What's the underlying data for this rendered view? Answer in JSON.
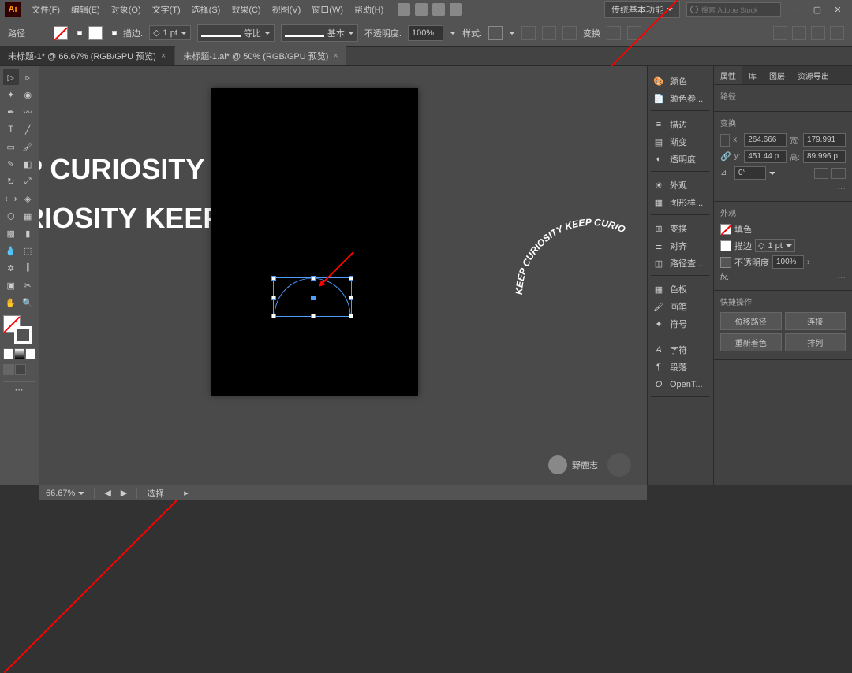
{
  "app": {
    "logo": "Ai",
    "workspace": "传统基本功能",
    "search_placeholder": "搜索 Adobe Stock"
  },
  "menu": {
    "items": [
      "文件(F)",
      "编辑(E)",
      "对象(O)",
      "文字(T)",
      "选择(S)",
      "效果(C)",
      "视图(V)",
      "窗口(W)",
      "帮助(H)"
    ]
  },
  "control": {
    "path_label": "路径",
    "stroke_label": "描边:",
    "stroke_weight": "1 pt",
    "uniform": "等比",
    "basic": "基本",
    "opacity_label": "不透明度:",
    "opacity": "100%",
    "style_label": "样式:",
    "transform_label": "变换"
  },
  "tabs": [
    {
      "label": "未标题-1* @ 66.67% (RGB/GPU 预览)",
      "active": true
    },
    {
      "label": "未标题-1.ai* @ 50% (RGB/GPU 预览)",
      "active": false
    }
  ],
  "panels": {
    "color": "颜色",
    "color_guide": "颜色参...",
    "stroke": "描边",
    "gradient": "渐变",
    "transparency": "透明度",
    "appearance": "外观",
    "graphic_styles": "图形样...",
    "transform": "变换",
    "align": "对齐",
    "pathfinder": "路径查...",
    "swatches": "色板",
    "brushes": "画笔",
    "symbols": "符号",
    "character": "字符",
    "paragraph": "段落",
    "opentype": "OpenT..."
  },
  "properties": {
    "tabs": [
      "属性",
      "库",
      "图层",
      "资源导出"
    ],
    "path_label": "路径",
    "transform_label": "变换",
    "x": "264.666",
    "y": "451.44 p",
    "w": "179.991",
    "h": "89.996 p",
    "rotate": "0°",
    "appearance_label": "外观",
    "fill_label": "填色",
    "stroke_label": "描边",
    "stroke_val": "1 pt",
    "opacity_label": "不透明度",
    "opacity_val": "100%",
    "fx": "fx.",
    "quick_label": "快捷操作",
    "offset_path": "位移路径",
    "join": "连接",
    "recolor": "重新着色",
    "arrange": "排列"
  },
  "status": {
    "zoom": "66.67%",
    "tool": "选择"
  },
  "canvas": {
    "bg_text1": "P CURIOSITY",
    "bg_text2": "RIOSITY KEEP"
  },
  "watermark": "野鹿志"
}
